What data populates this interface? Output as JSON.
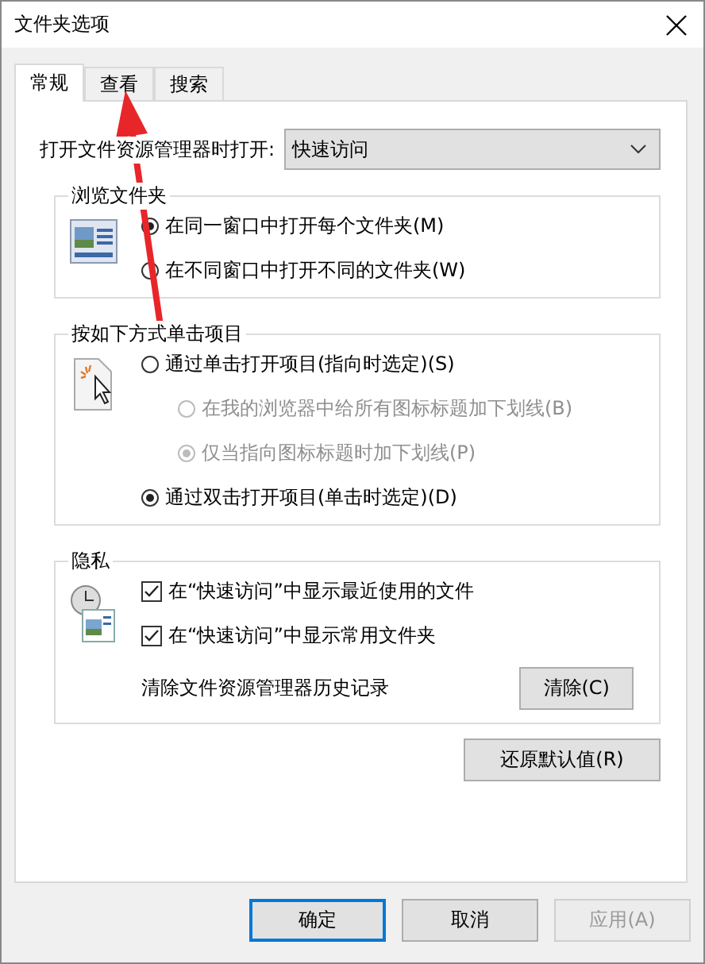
{
  "window": {
    "title": "文件夹选项"
  },
  "tabs": [
    {
      "label": "常规",
      "selected": true
    },
    {
      "label": "查看",
      "selected": false
    },
    {
      "label": "搜索",
      "selected": false
    }
  ],
  "open_with": {
    "label": "打开文件资源管理器时打开:",
    "value": "快速访问"
  },
  "groups": [
    {
      "title": "浏览文件夹",
      "options": [
        {
          "kind": "radio",
          "label": "在同一窗口中打开每个文件夹(M)",
          "selected": true,
          "disabled": false
        },
        {
          "kind": "radio",
          "label": "在不同窗口中打开不同的文件夹(W)",
          "selected": false,
          "disabled": false
        }
      ]
    },
    {
      "title": "按如下方式单击项目",
      "options": [
        {
          "kind": "radio",
          "label": "通过单击打开项目(指向时选定)(S)",
          "selected": false,
          "disabled": false,
          "children": [
            {
              "kind": "radio",
              "label": "在我的浏览器中给所有图标标题加下划线(B)",
              "selected": false,
              "disabled": true
            },
            {
              "kind": "radio",
              "label": "仅当指向图标标题时加下划线(P)",
              "selected": true,
              "disabled": true
            }
          ]
        },
        {
          "kind": "radio",
          "label": "通过双击打开项目(单击时选定)(D)",
          "selected": true,
          "disabled": false
        }
      ]
    },
    {
      "title": "隐私",
      "options": [
        {
          "kind": "checkbox",
          "label": "在“快速访问”中显示最近使用的文件",
          "checked": true
        },
        {
          "kind": "checkbox",
          "label": "在“快速访问”中显示常用文件夹",
          "checked": true
        },
        {
          "kind": "action",
          "label": "清除文件资源管理器历史记录",
          "button": "清除(C)"
        }
      ]
    }
  ],
  "restore_button": "还原默认值(R)",
  "buttons": [
    {
      "label": "确定",
      "default": true,
      "disabled": false
    },
    {
      "label": "取消",
      "default": false,
      "disabled": false
    },
    {
      "label": "应用(A)",
      "default": false,
      "disabled": true
    }
  ]
}
